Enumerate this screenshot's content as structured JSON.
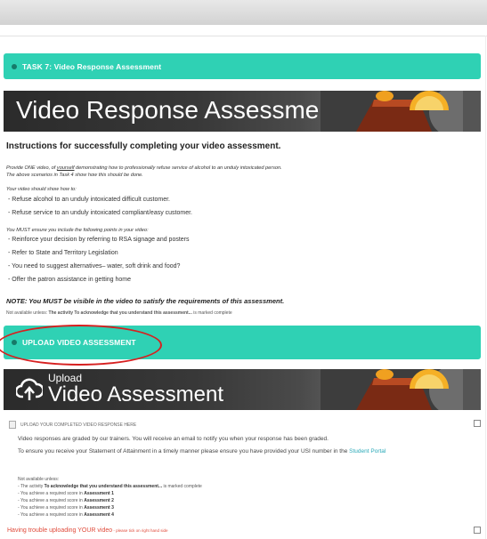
{
  "task7": {
    "title": "TASK 7: Video Response Assessment",
    "banner_text": "Video Response Assessment",
    "heading": "Instructions for successfully completing your video assessment.",
    "provide_pre": "Provide ONE video, of ",
    "provide_underline": "yourself",
    "provide_post": " demonstrating how to professionally refuse service of alcohol to an unduly intoxicated person.",
    "scenarios": "The above scenarios in Task 4 show how this should be done.",
    "should_show": "Your video should show how to:",
    "show_items": [
      "Refuse alcohol to an unduly intoxicated difficult customer.",
      "Refuse service to an unduly intoxicated compliant/easy customer."
    ],
    "must_include": "You MUST ensure you include the following points in your video:",
    "include_items": [
      "Reinforce your decision by referring to RSA signage and posters",
      "Refer to State and Territory Legislation",
      "You need to suggest alternatives– water, soft drink and food?",
      "Offer the patron assistance in getting home"
    ],
    "note": "NOTE: You MUST be visible in the video to satisfy the requirements of this assessment.",
    "not_available_pre": "Not available unless: ",
    "not_available_bold": "The activity To acknowledge that you understand this assessment...",
    "not_available_post": " is marked complete"
  },
  "upload": {
    "title": "UPLOAD VIDEO ASSESSMENT",
    "banner_small": "Upload",
    "banner_big": "Video Assessment",
    "item_label": "UPLOAD YOUR COMPLETED VIDEO RESPONSE HERE",
    "para1": "Video responses are graded by our trainers. You will receive an email to notify you when your response has been graded.",
    "para2_pre": "To ensure you receive your Statement of Attainment in a timely manner please ensure you have provided your USI number in the ",
    "para2_link": "Student Portal",
    "na_header": "Not available unless:",
    "na_items": [
      {
        "pre": "The activity ",
        "bold": "To acknowledge that you understand this assessment...",
        "post": " is marked complete"
      },
      {
        "pre": "You achieve a required score in ",
        "bold": "Assessment 1",
        "post": ""
      },
      {
        "pre": "You achieve a required score in ",
        "bold": "Assessment 2",
        "post": ""
      },
      {
        "pre": "You achieve a required score in ",
        "bold": "Assessment 3",
        "post": ""
      },
      {
        "pre": "You achieve a required score in ",
        "bold": "Assessment 4",
        "post": ""
      }
    ],
    "trouble_main": "Having trouble uploading YOUR video",
    "trouble_sub": " - please tick on right hand side"
  },
  "colors": {
    "section_bar": "#2fd1b4",
    "annotation_circle": "#d62020",
    "trouble_text": "#e04a3a",
    "link": "#2aa9b8"
  },
  "icons": [
    "cloud-upload-icon",
    "file-icon",
    "cocktail-image"
  ]
}
